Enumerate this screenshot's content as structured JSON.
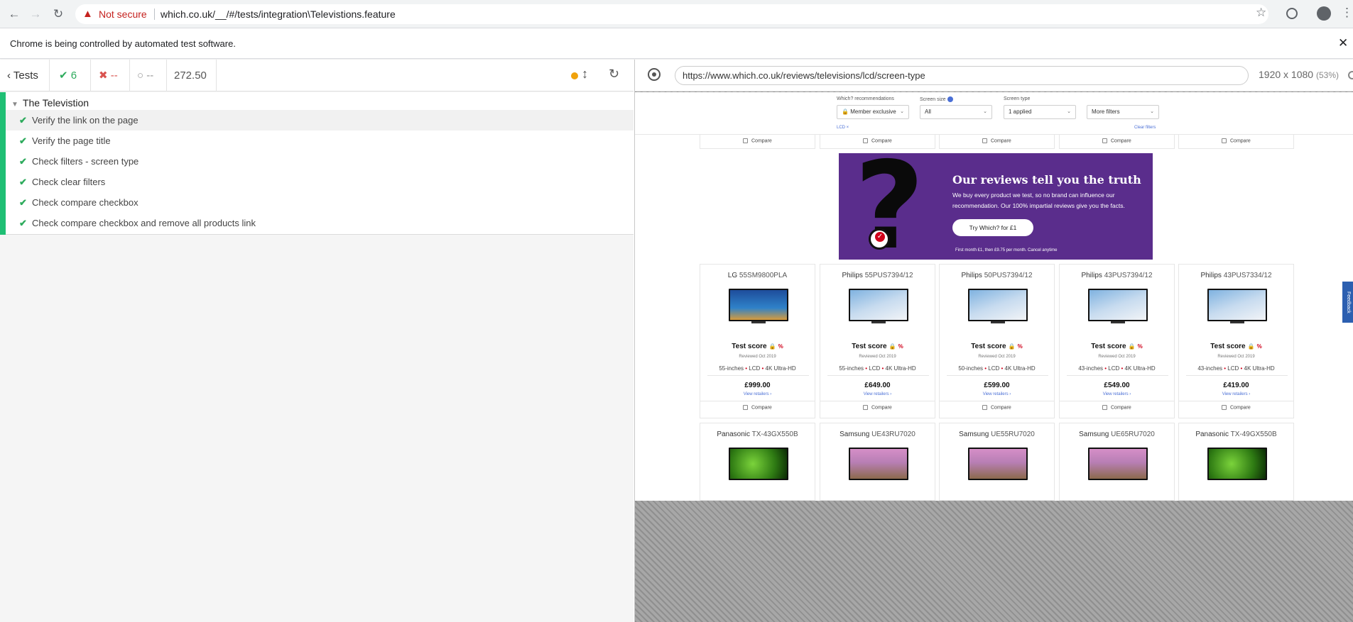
{
  "browser": {
    "security_label": "Not secure",
    "url": "which.co.uk/__/#/tests/integration\\Televistions.feature",
    "infobar_text": "Chrome is being controlled by automated test software."
  },
  "reporter": {
    "back_label": "Tests",
    "passed": "6",
    "failed": "--",
    "pending": "--",
    "duration": "272.50",
    "suite_title": "The Televistion",
    "tests": [
      {
        "label": "Verify the link on the page"
      },
      {
        "label": "Verify the page title"
      },
      {
        "label": "Check filters - screen type"
      },
      {
        "label": "Check clear filters"
      },
      {
        "label": "Check compare checkbox"
      },
      {
        "label": "Check compare checkbox and remove all products link"
      }
    ]
  },
  "aut": {
    "url": "https://www.which.co.uk/reviews/televisions/lcd/screen-type",
    "viewport": "1920 x 1080",
    "zoom": "(53%)"
  },
  "page": {
    "filters": {
      "recommendations_label": "Which? recommendations",
      "recommendations_value": "Member exclusive",
      "screen_size_label": "Screen size",
      "screen_size_value": "All",
      "screen_type_label": "Screen type",
      "screen_type_value": "1 applied",
      "more_filters": "More filters",
      "chip": "LCD ×",
      "clear_filters": "Clear filters"
    },
    "compare_label": "Compare",
    "promo": {
      "title": "Our reviews tell you the truth",
      "body": "We buy every product we test, so no brand can influence our recommendation. Our 100% impartial reviews give you the facts.",
      "button": "Try Which? for £1",
      "fine_print": "First month £1, then £9.75 per month. Cancel anytime"
    },
    "test_score_label": "Test score",
    "percent_sign": "%",
    "view_retailers": "View retailers ›",
    "products_row1": [
      {
        "brand": "LG",
        "model": "55SM9800PLA",
        "image": "balloon",
        "reviewed": "Reviewed Oct 2019",
        "size": "55-inches",
        "type": "LCD",
        "res": "4K Ultra-HD",
        "price": "£999.00"
      },
      {
        "brand": "Philips",
        "model": "55PUS7394/12",
        "image": "ski",
        "reviewed": "Reviewed Oct 2019",
        "size": "55-inches",
        "type": "LCD",
        "res": "4K Ultra-HD",
        "price": "£649.00"
      },
      {
        "brand": "Philips",
        "model": "50PUS7394/12",
        "image": "ski",
        "reviewed": "Reviewed Oct 2019",
        "size": "50-inches",
        "type": "LCD",
        "res": "4K Ultra-HD",
        "price": "£599.00"
      },
      {
        "brand": "Philips",
        "model": "43PUS7394/12",
        "image": "ski",
        "reviewed": "Reviewed Oct 2019",
        "size": "43-inches",
        "type": "LCD",
        "res": "4K Ultra-HD",
        "price": "£549.00"
      },
      {
        "brand": "Philips",
        "model": "43PUS7334/12",
        "image": "ski",
        "reviewed": "Reviewed Oct 2019",
        "size": "43-inches",
        "type": "LCD",
        "res": "4K Ultra-HD",
        "price": "£419.00"
      }
    ],
    "products_row2": [
      {
        "brand": "Panasonic",
        "model": "TX-43GX550B",
        "image": "chameleon"
      },
      {
        "brand": "Samsung",
        "model": "UE43RU7020",
        "image": "mountain"
      },
      {
        "brand": "Samsung",
        "model": "UE55RU7020",
        "image": "mountain"
      },
      {
        "brand": "Samsung",
        "model": "UE65RU7020",
        "image": "mountain"
      },
      {
        "brand": "Panasonic",
        "model": "TX-49GX550B",
        "image": "chameleon"
      }
    ],
    "feedback_label": "Feedback"
  }
}
